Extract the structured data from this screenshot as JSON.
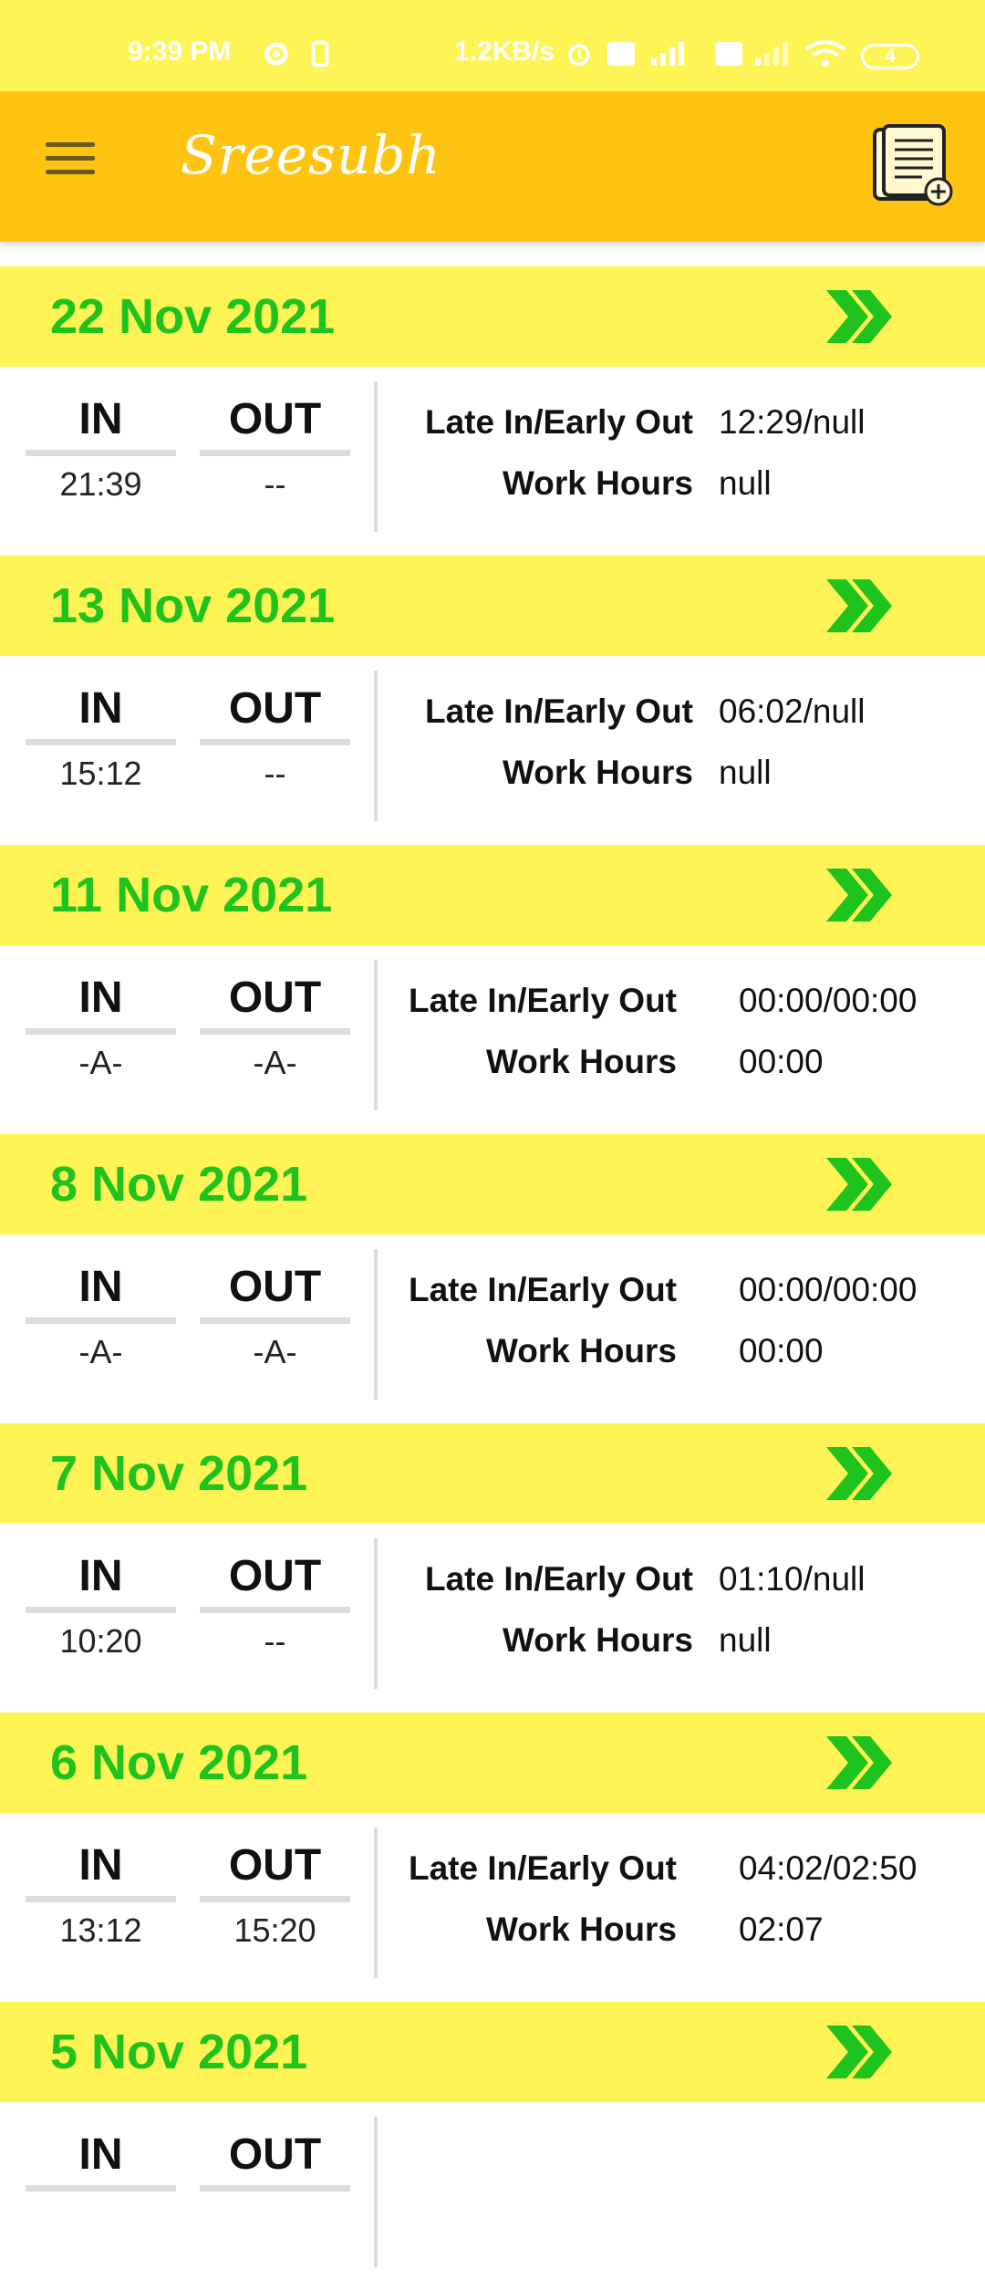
{
  "status": {
    "time": "9:39 PM",
    "net_speed": "1.2KB/s",
    "battery": "4"
  },
  "appbar": {
    "title": "Sreesubh",
    "icons": [
      "menu-icon",
      "document-add-icon"
    ]
  },
  "labels": {
    "in": "IN",
    "out": "OUT",
    "late_early": "Late In/Early Out",
    "work_hours": "Work Hours"
  },
  "records": [
    {
      "date": "22 Nov 2021",
      "in": "21:39",
      "out": "--",
      "late_early": "12:29/null",
      "work_hours": "null"
    },
    {
      "date": "13 Nov 2021",
      "in": "15:12",
      "out": "--",
      "late_early": "06:02/null",
      "work_hours": "null"
    },
    {
      "date": "11 Nov 2021",
      "in": "-A-",
      "out": "-A-",
      "late_early": "00:00/00:00",
      "work_hours": "00:00"
    },
    {
      "date": "8 Nov 2021",
      "in": "-A-",
      "out": "-A-",
      "late_early": "00:00/00:00",
      "work_hours": "00:00"
    },
    {
      "date": "7 Nov 2021",
      "in": "10:20",
      "out": "--",
      "late_early": "01:10/null",
      "work_hours": "null"
    },
    {
      "date": "6 Nov 2021",
      "in": "13:12",
      "out": "15:20",
      "late_early": "04:02/02:50",
      "work_hours": "02:07"
    },
    {
      "date": "5 Nov 2021",
      "in": "",
      "out": "",
      "late_early": "",
      "work_hours": ""
    }
  ],
  "colors": {
    "header_bg": "#ffc412",
    "status_bg": "#fff456",
    "date_green": "#1ec31e",
    "divider": "#dcdcdc"
  }
}
